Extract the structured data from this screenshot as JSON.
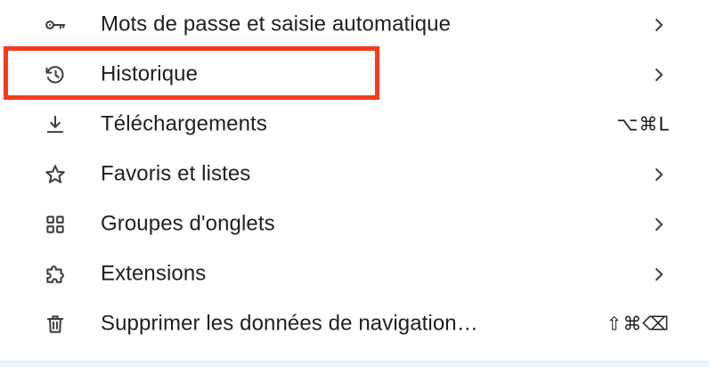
{
  "menu": {
    "items": [
      {
        "label": "Mots de passe et saisie automatique",
        "icon": "key-icon",
        "trailing": "chevron"
      },
      {
        "label": "Historique",
        "icon": "history-icon",
        "trailing": "chevron"
      },
      {
        "label": "Téléchargements",
        "icon": "download-icon",
        "trailing": "shortcut",
        "shortcut": "⌥⌘L"
      },
      {
        "label": "Favoris et listes",
        "icon": "star-icon",
        "trailing": "chevron"
      },
      {
        "label": "Groupes d'onglets",
        "icon": "grid-icon",
        "trailing": "chevron"
      },
      {
        "label": "Extensions",
        "icon": "puzzle-icon",
        "trailing": "chevron"
      },
      {
        "label": "Supprimer les données de navigation…",
        "icon": "trash-icon",
        "trailing": "shortcut",
        "shortcut": "⇧⌘⌫"
      }
    ]
  },
  "highlight": {
    "target": "Historique",
    "color": "#f53b1f"
  },
  "colors": {
    "text": "#1f1f1f",
    "icon": "#3c4043",
    "background": "#ffffff"
  }
}
